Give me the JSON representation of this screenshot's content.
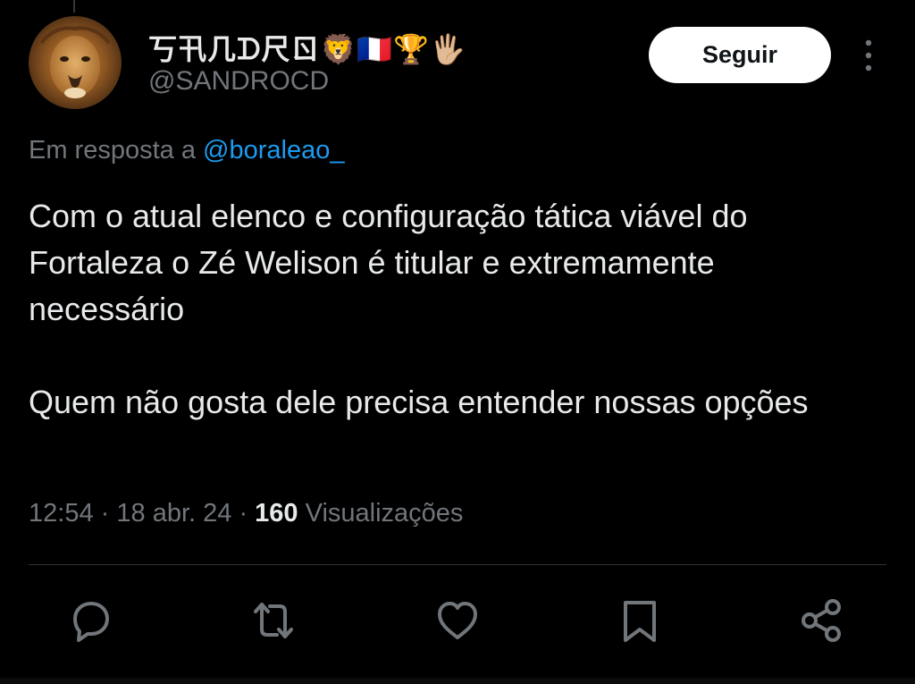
{
  "tweet": {
    "author": {
      "display_name": "丂卂几ᗪ尺ㄖ🦁🇫🇷🏆🖐🏼",
      "handle": "@SANDROCD",
      "avatar": "lion-avatar"
    },
    "follow_label": "Seguir",
    "more_icon": "more-vertical-icon",
    "reply_context": {
      "prefix": "Em resposta a",
      "mention": "@boraleao_",
      "mention_color": "#1d9bf0"
    },
    "paragraphs": [
      "Com o atual elenco e configuração tática viável do Fortaleza o Zé Welison é titular e extremamente necessário",
      "Quem não gosta dele precisa entender nossas opções"
    ],
    "meta": {
      "time": "12:54",
      "separator": "·",
      "date": "18 abr. 24",
      "views_count": "160",
      "views_label": "Visualizações"
    },
    "actions": [
      {
        "name": "reply",
        "icon": "reply-icon"
      },
      {
        "name": "retweet",
        "icon": "retweet-icon"
      },
      {
        "name": "like",
        "icon": "heart-icon"
      },
      {
        "name": "bookmark",
        "icon": "bookmark-icon"
      },
      {
        "name": "share",
        "icon": "share-icon"
      }
    ]
  },
  "theme": {
    "background": "#000000",
    "text_primary": "#e7e9ea",
    "text_secondary": "#71767b",
    "divider": "#2f3336",
    "follow_button_bg": "#ffffff",
    "follow_button_text": "#0f1419"
  }
}
